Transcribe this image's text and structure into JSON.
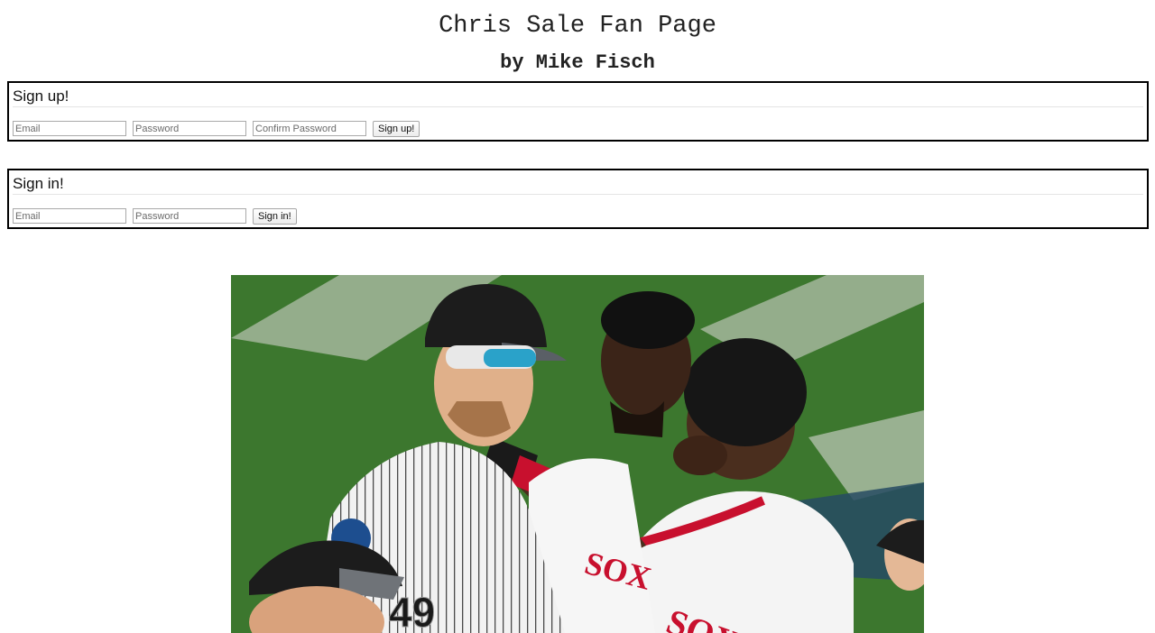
{
  "header": {
    "title": "Chris Sale Fan Page",
    "byline": "by Mike Fisch"
  },
  "signup": {
    "heading": "Sign up!",
    "email_placeholder": "Email",
    "password_placeholder": "Password",
    "confirm_placeholder": "Confirm Password",
    "button_label": "Sign up!"
  },
  "signin": {
    "heading": "Sign in!",
    "email_placeholder": "Email",
    "password_placeholder": "Password",
    "button_label": "Sign in!"
  },
  "photo": {
    "jersey_number": "49",
    "jersey_text": "SOX"
  },
  "colors": {
    "field_green": "#3f7a2f",
    "sox_red": "#c8102e",
    "whitesox_black": "#1a1a1a"
  }
}
